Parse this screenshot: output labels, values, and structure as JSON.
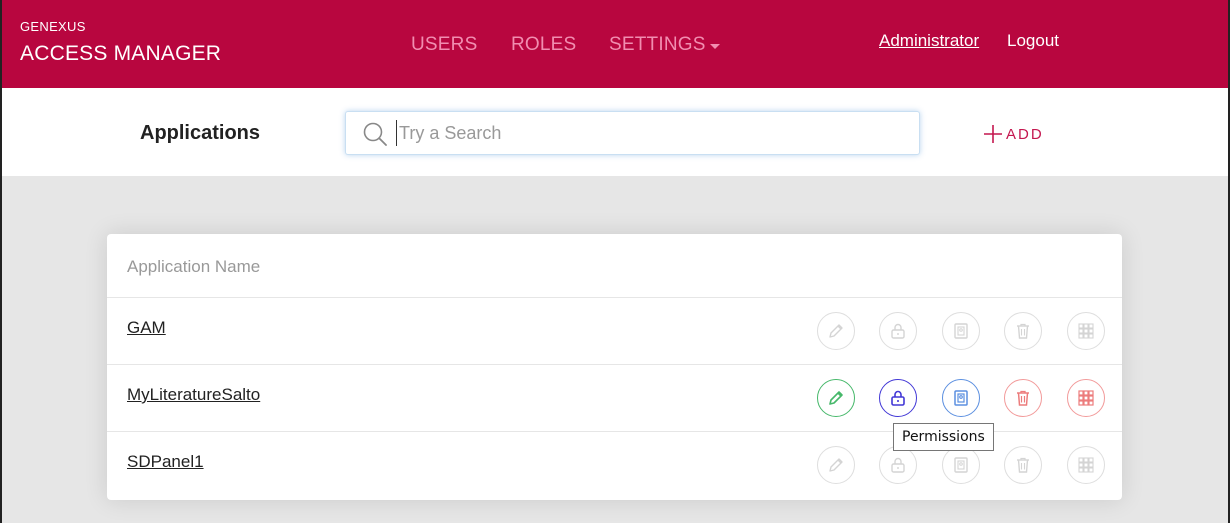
{
  "header": {
    "brand_small": "GENEXUS",
    "brand_big": "ACCESS MANAGER",
    "nav": [
      {
        "label": "USERS"
      },
      {
        "label": "ROLES"
      },
      {
        "label": "SETTINGS"
      }
    ],
    "user_label": "Administrator",
    "logout_label": "Logout"
  },
  "toolbar": {
    "title": "Applications",
    "search_placeholder": "Try a Search",
    "search_value": "",
    "add_label": "ADD"
  },
  "table": {
    "column_header": "Application Name",
    "rows": [
      {
        "name": "GAM",
        "actions_state": "disabled"
      },
      {
        "name": "MyLiteratureSalto",
        "actions_state": "enabled"
      },
      {
        "name": "SDPanel1",
        "actions_state": "disabled"
      }
    ],
    "actions": [
      {
        "icon": "pencil-icon"
      },
      {
        "icon": "lock-icon"
      },
      {
        "icon": "permissions-icon"
      },
      {
        "icon": "trash-icon"
      },
      {
        "icon": "grid-icon"
      }
    ]
  },
  "tooltip": "Permissions",
  "colors": {
    "brand": "#b8063f",
    "nav_text": "#f18db0",
    "add_accent": "#c4174f",
    "edit_green": "#46b86a",
    "lock_blue": "#4238d6",
    "permissions_blue": "#5b8fe0",
    "delete_red": "#ec7c7c"
  }
}
